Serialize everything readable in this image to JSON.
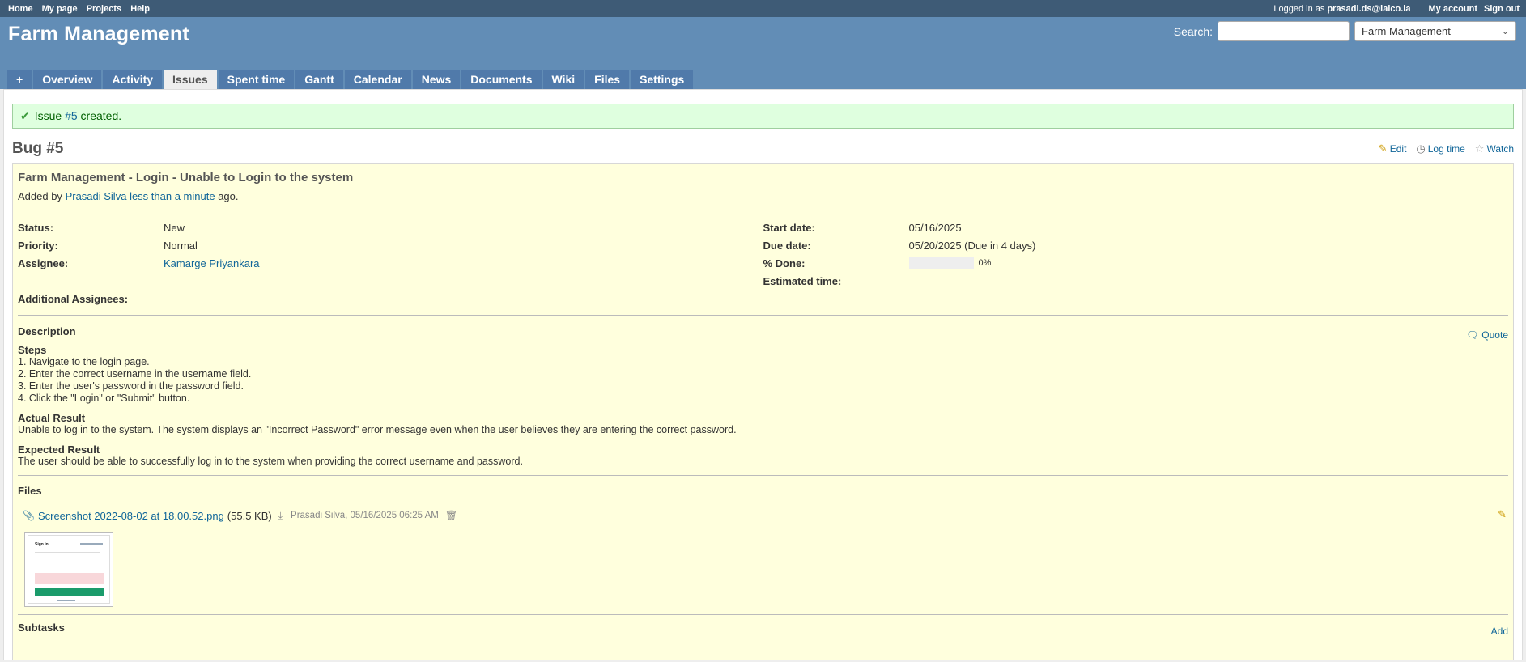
{
  "top_menu": {
    "left": [
      "Home",
      "My page",
      "Projects",
      "Help"
    ],
    "logged_in_prefix": "Logged in as",
    "user": "prasadi.ds@lalco.la",
    "my_account": "My account",
    "sign_out": "Sign out"
  },
  "header": {
    "title": "Farm Management",
    "search_label": "Search:",
    "search_value": "",
    "project_select": "Farm Management"
  },
  "tabs": [
    {
      "label": "+",
      "selected": false
    },
    {
      "label": "Overview",
      "selected": false
    },
    {
      "label": "Activity",
      "selected": false
    },
    {
      "label": "Issues",
      "selected": true
    },
    {
      "label": "Spent time",
      "selected": false
    },
    {
      "label": "Gantt",
      "selected": false
    },
    {
      "label": "Calendar",
      "selected": false
    },
    {
      "label": "News",
      "selected": false
    },
    {
      "label": "Documents",
      "selected": false
    },
    {
      "label": "Wiki",
      "selected": false
    },
    {
      "label": "Files",
      "selected": false
    },
    {
      "label": "Settings",
      "selected": false
    }
  ],
  "flash": {
    "prefix": "Issue ",
    "link": "#5",
    "suffix": " created."
  },
  "issue": {
    "heading": "Bug #5",
    "actions": {
      "edit": "Edit",
      "log_time": "Log time",
      "watch": "Watch"
    },
    "subject": "Farm Management - Login - Unable to Login to the system",
    "added_by_prefix": "Added by",
    "author": "Prasadi Silva",
    "age": "less than a minute",
    "ago": "ago.",
    "left_attrs": [
      {
        "key": "Status:",
        "value": "New",
        "link": false
      },
      {
        "key": "Priority:",
        "value": "Normal",
        "link": false
      },
      {
        "key": "Assignee:",
        "value": "Kamarge Priyankara",
        "link": true
      }
    ],
    "right_attrs": {
      "start_date_label": "Start date:",
      "start_date": "05/16/2025",
      "due_date_label": "Due date:",
      "due_date": "05/20/2025 (Due in 4 days)",
      "done_label": "% Done:",
      "done_value": "0%",
      "done_fraction": 0,
      "estimated_label": "Estimated time:",
      "estimated_value": ""
    },
    "additional_assignees_label": "Additional Assignees:",
    "description_title": "Description",
    "quote": "Quote",
    "description": {
      "steps_title": "Steps",
      "steps": [
        "1. Navigate to the login page.",
        "2. Enter the correct username in the username field.",
        "3. Enter the user's password in the password field.",
        "4. Click the \"Login\" or \"Submit\" button."
      ],
      "actual_title": "Actual Result",
      "actual": "Unable to log in to the system. The system displays an \"Incorrect Password\" error message even when the user believes they are entering the correct password.",
      "expected_title": "Expected Result",
      "expected": "The user should be able to successfully log in to the system when providing the correct username and password."
    },
    "files_title": "Files",
    "attachment": {
      "name": "Screenshot 2022-08-02 at 18.00.52.png",
      "size": "(55.5 KB)",
      "meta": "Prasadi Silva, 05/16/2025 06:25 AM",
      "thumb_title": "Sign in"
    },
    "subtasks_title": "Subtasks",
    "subtasks_add": "Add"
  },
  "colors": {
    "top_menu_bg": "#3e5b76",
    "header_bg": "#628db6",
    "tab_bg": "#507aaa",
    "issue_bg": "#ffffdd",
    "flash_bg": "#dfffdf",
    "link": "#169"
  }
}
